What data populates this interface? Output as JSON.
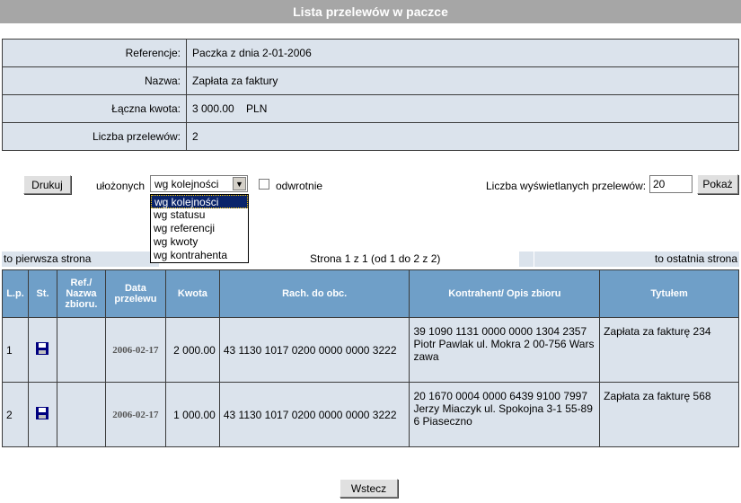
{
  "page": {
    "title": "Lista przelewów w paczce"
  },
  "info": [
    {
      "label": "Referencje:",
      "value": "Paczka z dnia 2-01-2006"
    },
    {
      "label": "Nazwa:",
      "value": "Zapłata za faktury"
    },
    {
      "label": "Łączna kwota:",
      "value": "3 000.00    PLN"
    },
    {
      "label": "Liczba przelewów:",
      "value": "2"
    }
  ],
  "controls": {
    "print_label": "Drukuj",
    "sort_label": "ułożonych",
    "sort_selected": "wg kolejności",
    "sort_options": [
      "wg kolejności",
      "wg statusu",
      "wg referencji",
      "wg kwoty",
      "wg kontrahenta"
    ],
    "reverse_label": "odwrotnie",
    "count_label": "Liczba wyświetlanych przelewów:",
    "count_value": "20",
    "show_label": "Pokaż"
  },
  "nav": {
    "first": "to pierwsza strona",
    "status": "Strona 1 z 1 (od 1 do 2 z 2)",
    "last": "to ostatnia strona"
  },
  "table": {
    "headers": {
      "lp": "L.p.",
      "st": "St.",
      "ref": "Ref./ Nazwa zbioru.",
      "date": "Data przelewu",
      "amount": "Kwota",
      "account": "Rach. do obc.",
      "contractor": "Kontrahent/ Opis zbioru",
      "title": "Tytułem"
    },
    "rows": [
      {
        "lp": "1",
        "ref": "",
        "date": "2006-02-17",
        "amount": "2 000.00",
        "account": "43 1130 1017 0200 0000 0000 3222",
        "contractor": "39 1090 1131 0000 0000 1304 2357 Piotr Pawlak ul. Mokra 2 00-756 Warszawa",
        "title": "Zapłata za fakturę 234"
      },
      {
        "lp": "2",
        "ref": "",
        "date": "2006-02-17",
        "amount": "1 000.00",
        "account": "43 1130 1017 0200 0000 0000 3222",
        "contractor": "20 1670 0004 0000 6439 9100 7997 Jerzy Miaczyk ul. Spokojna 3-1 55-896 Piaseczno",
        "title": "Zapłata za fakturę 568"
      }
    ]
  },
  "footer": {
    "back_label": "Wstecz"
  }
}
